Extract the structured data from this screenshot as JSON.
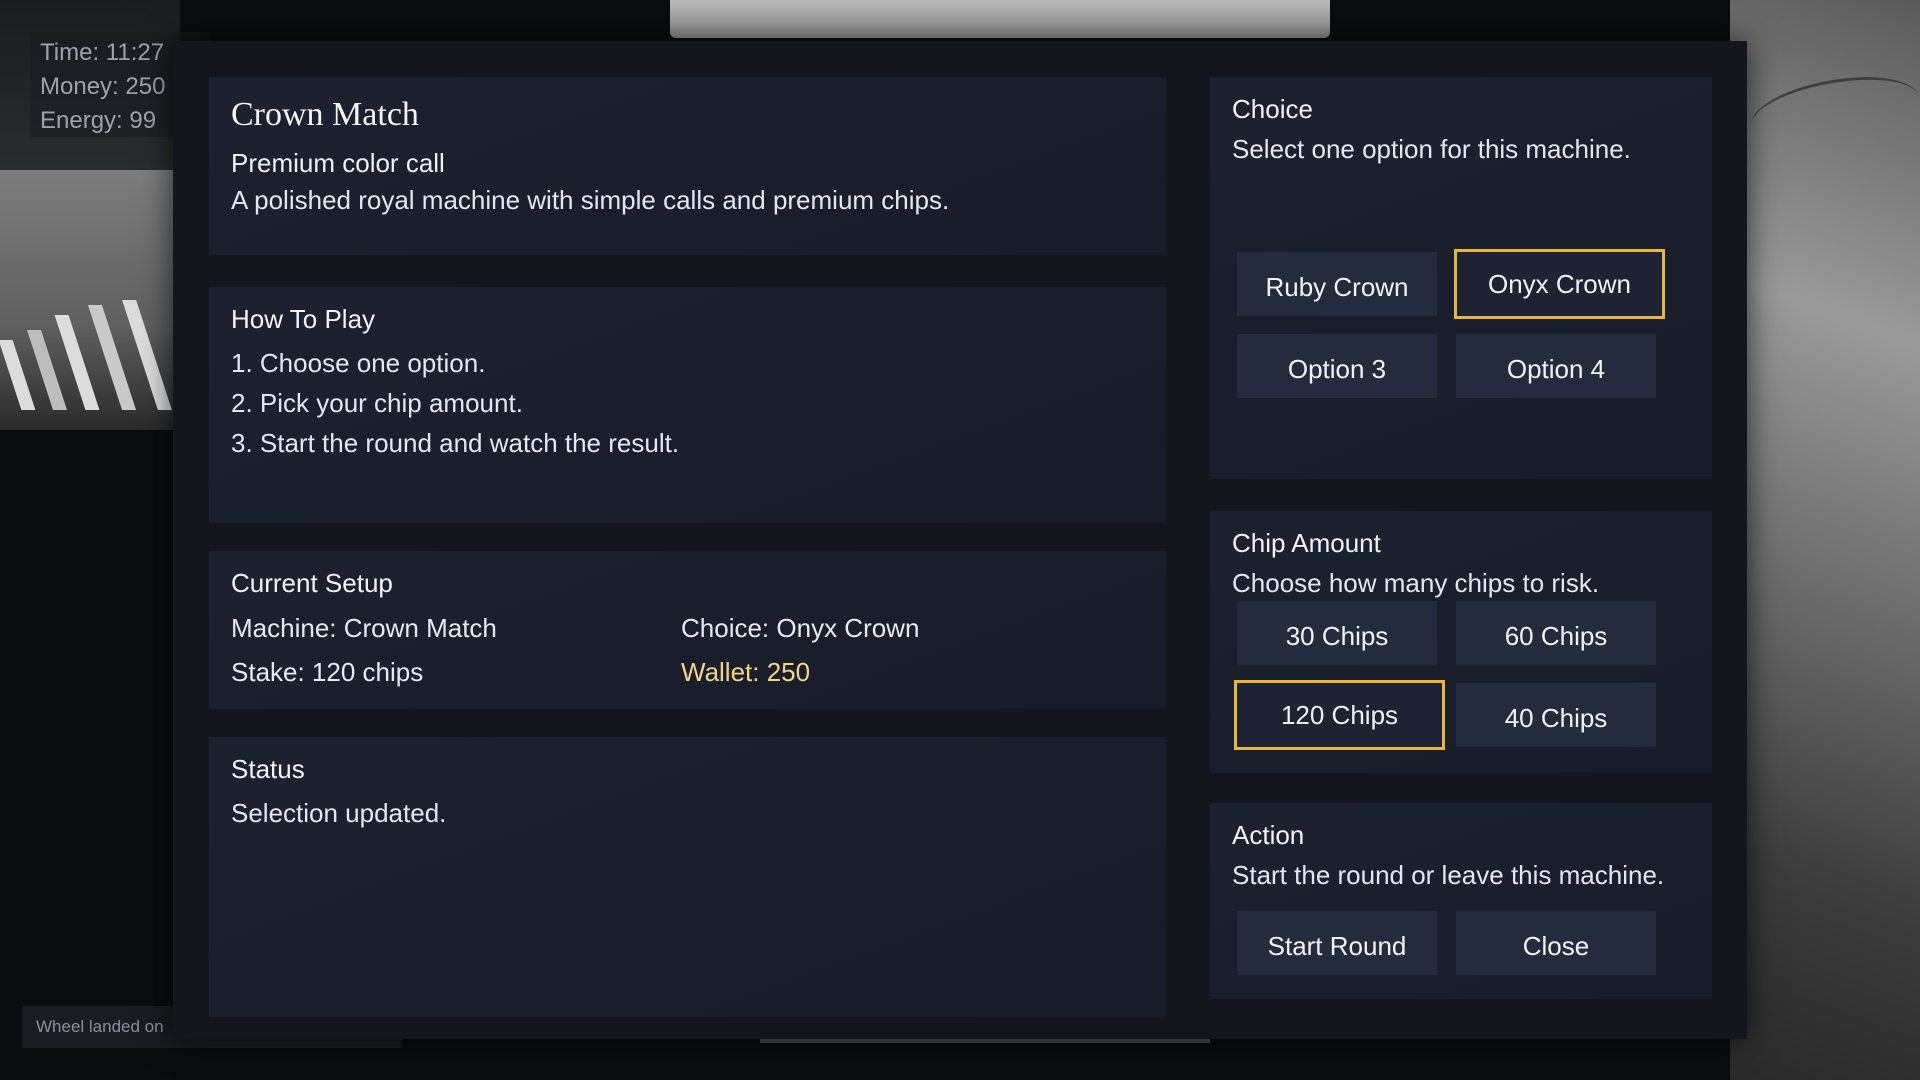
{
  "hud": {
    "time": "Time: 11:27",
    "money": "Money: 250",
    "energy": "Energy: 99"
  },
  "toast": "Wheel landed on",
  "machine": {
    "title": "Crown Match",
    "subtitle": "Premium color call",
    "description": "A polished royal machine with simple calls and premium chips."
  },
  "how_to_play": {
    "title": "How To Play",
    "steps": [
      "1. Choose one option.",
      "2. Pick your chip amount.",
      "3. Start the round and watch the result."
    ]
  },
  "setup": {
    "title": "Current Setup",
    "machine": "Machine: Crown Match",
    "choice": "Choice: Onyx Crown",
    "stake": "Stake: 120 chips",
    "wallet": "Wallet: 250"
  },
  "status": {
    "title": "Status",
    "message": "Selection updated."
  },
  "choice": {
    "title": "Choice",
    "hint": "Select one option for this machine.",
    "options": [
      "Ruby Crown",
      "Onyx Crown",
      "Option 3",
      "Option 4"
    ],
    "selected": "Onyx Crown"
  },
  "chips": {
    "title": "Chip Amount",
    "hint": "Choose how many chips to risk.",
    "options": [
      "30 Chips",
      "60 Chips",
      "120 Chips",
      "40 Chips"
    ],
    "selected": "120 Chips"
  },
  "action": {
    "title": "Action",
    "hint": "Start the round or leave this machine.",
    "start_label": "Start Round",
    "close_label": "Close"
  },
  "colors": {
    "selected_border": "#e7b63a",
    "wallet_text": "#f2d58c",
    "button_bg": "#242b3d",
    "card_bg": "#1c2130"
  }
}
